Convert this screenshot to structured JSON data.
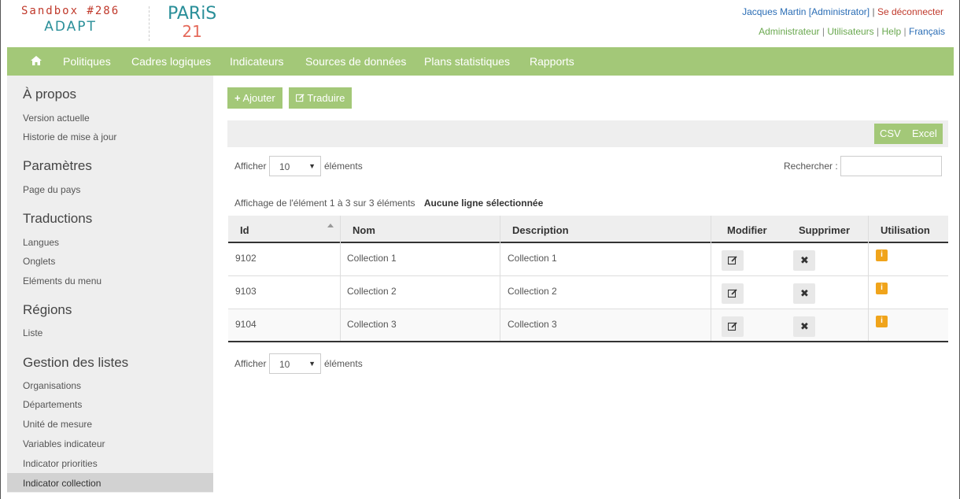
{
  "header": {
    "brand_line1": "Sandbox #286",
    "brand_line2": "ADAPT",
    "partner_logo_line1": "PARiS",
    "partner_logo_line2": "21",
    "user": "Jacques Martin [Administrator]",
    "separator": "|",
    "logout": "Se déconnecter",
    "links": [
      "Administrateur",
      "Utilisateurs",
      "Help"
    ],
    "language": "Français"
  },
  "nav": {
    "home_icon": "home-icon",
    "items": [
      "Politiques",
      "Cadres logiques",
      "Indicateurs",
      "Sources de données",
      "Plans statistiques",
      "Rapports"
    ]
  },
  "sidebar": {
    "sections": [
      {
        "title": "À propos",
        "items": [
          "Version actuelle",
          "Historie de mise à jour"
        ]
      },
      {
        "title": "Paramètres",
        "items": [
          "Page du pays"
        ]
      },
      {
        "title": "Traductions",
        "items": [
          "Langues",
          "Onglets",
          "Eléments du menu"
        ]
      },
      {
        "title": "Régions",
        "items": [
          "Liste"
        ]
      },
      {
        "title": "Gestion des listes",
        "items": [
          "Organisations",
          "Départements",
          "Unité de mesure",
          "Variables indicateur",
          "Indicator priorities",
          "Indicator collection"
        ]
      }
    ],
    "active_item": "Indicator collection"
  },
  "main": {
    "add_button": "Ajouter",
    "translate_button": "Traduire",
    "csv_button": "CSV",
    "excel_button": "Excel",
    "show_label": "Afficher",
    "page_size": "10",
    "entries_label": "éléments",
    "search_label": "Rechercher :",
    "info": "Affichage de l'élément 1 à 3 sur 3 éléments",
    "selection_info": "Aucune ligne sélectionnée"
  },
  "table": {
    "columns": [
      "Id",
      "Nom",
      "Description",
      "Modifier",
      "Supprimer",
      "Utilisation"
    ],
    "rows": [
      {
        "id": "9102",
        "nom": "Collection 1",
        "description": "Collection 1"
      },
      {
        "id": "9103",
        "nom": "Collection 2",
        "description": "Collection 2"
      },
      {
        "id": "9104",
        "nom": "Collection 3",
        "description": "Collection 3"
      }
    ]
  },
  "icons": {
    "edit": "edit-icon",
    "delete": "delete-icon",
    "usage": "info-icon",
    "sort": "sort-asc-icon"
  },
  "colors": {
    "accent_green": "#a3c878",
    "brand_red": "#c0392b",
    "brand_teal": "#2a8f99",
    "info_orange": "#f0a41b"
  }
}
